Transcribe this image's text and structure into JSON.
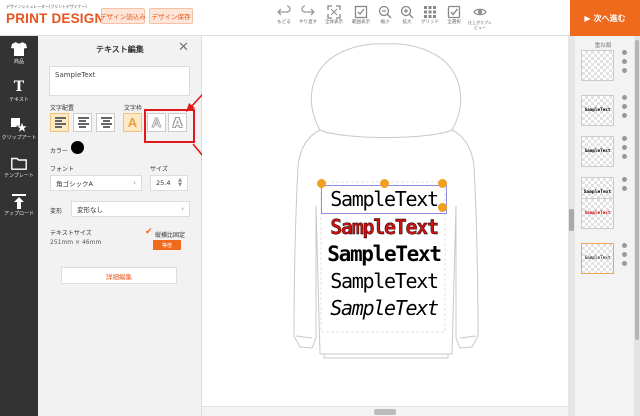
{
  "header": {
    "logo_sub": "デザインシミュレーター(プリントデザイナー)",
    "logo_main": "PRINT DESIGNER",
    "load_button": "デザイン読込み",
    "save_button": "デザイン保存",
    "tools": [
      "もどる",
      "やり直す",
      "全体表示",
      "範囲表示",
      "縮小",
      "拡大",
      "グリッド",
      "全選択",
      "仕上がりプレビュー"
    ],
    "next_button": "次へ進む",
    "next_icon": "▶"
  },
  "nav": [
    {
      "label": "商品",
      "icon": "shirt-icon"
    },
    {
      "label": "テキスト",
      "icon": "text-icon"
    },
    {
      "label": "クリップアート",
      "icon": "clipart-icon"
    },
    {
      "label": "テンプレート",
      "icon": "folder-icon"
    },
    {
      "label": "アップロード",
      "icon": "upload-icon"
    }
  ],
  "panel": {
    "title": "テキスト編集",
    "close": "✕",
    "text_value": "SampleText",
    "alignment_label": "文字配置",
    "style_label": "文字枠",
    "style_glyphs": [
      "A",
      "A",
      "A"
    ],
    "color_label": "カラー",
    "font_label": "フォント",
    "font_value": "角ゴシックA",
    "size_label": "サイズ",
    "size_value": "25.4",
    "transform_label": "変形",
    "transform_value": "変形なし",
    "textsize_label": "テキストサイズ",
    "textsize_value": "251mm × 46mm",
    "lock_ratio_label": "縦横比固定",
    "lock_ratio_checked": true,
    "equal_button": "等倍",
    "detail_button": "詳細編集"
  },
  "canvas": {
    "lines": [
      {
        "text": "SampleText",
        "style": "plain"
      },
      {
        "text": "SampleText",
        "style": "red-outline"
      },
      {
        "text": "SampleText",
        "style": "bold"
      },
      {
        "text": "SampleText",
        "style": "plain-tall"
      },
      {
        "text": "SampleText",
        "style": "italic"
      }
    ]
  },
  "layers": {
    "title": "重ね順",
    "items": [
      {
        "text": "",
        "selected": false
      },
      {
        "text": "SampleText",
        "selected": false
      },
      {
        "text": "SampleText",
        "selected": false
      },
      {
        "text": "SampleText",
        "selected": false
      },
      {
        "text": "SampleText",
        "selected": false
      },
      {
        "text": "SampleText",
        "selected": true
      }
    ]
  },
  "colors": {
    "accent": "#f06a1e",
    "brand": "#e8541c",
    "highlight_box": "#e01a1a",
    "text_color": "#000000",
    "second_line": "#cc1111"
  }
}
